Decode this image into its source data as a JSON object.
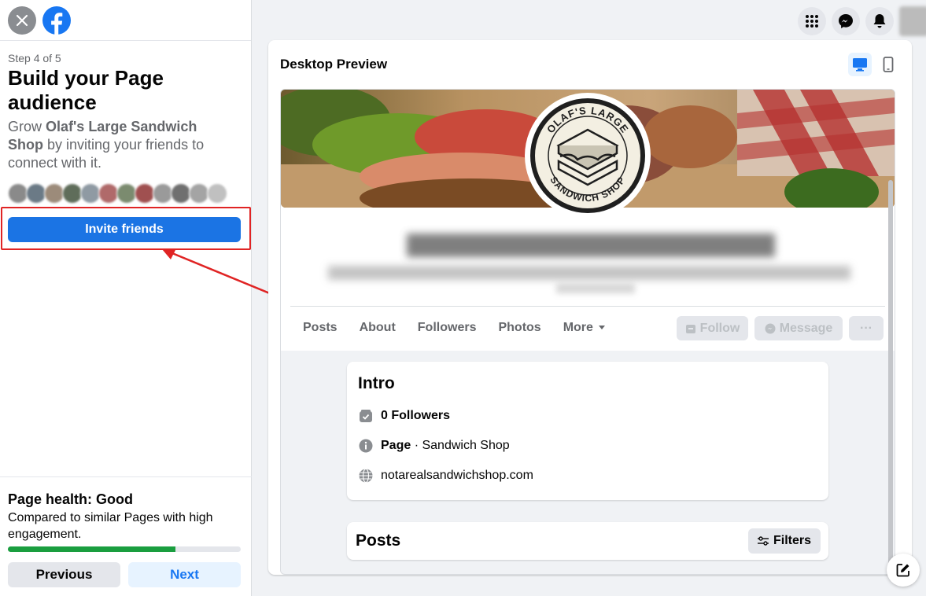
{
  "sidebar": {
    "step": "Step 4 of 5",
    "title": "Build your Page audience",
    "desc_pre": "Grow ",
    "page_name": "Olaf's Large Sandwich Shop",
    "desc_post": " by inviting your friends to connect with it.",
    "invite_label": "Invite friends",
    "health_title": "Page health: Good",
    "health_desc": "Compared to similar Pages with high engagement.",
    "health_progress": 0.72,
    "previous_label": "Previous",
    "next_label": "Next"
  },
  "preview": {
    "title": "Desktop Preview",
    "logo_top": "OLAF'S LARGE",
    "logo_bottom": "SANDWICH SHOP",
    "tabs": [
      "Posts",
      "About",
      "Followers",
      "Photos",
      "More"
    ],
    "follow_label": "Follow",
    "message_label": "Message",
    "more_actions": "···",
    "intro_title": "Intro",
    "followers": "0 Followers",
    "page_label": "Page",
    "page_category": " · Sandwich Shop",
    "website": "notarealsandwichshop.com",
    "posts_title": "Posts",
    "filters_label": "Filters"
  },
  "colors": {
    "primary": "#1b74e4",
    "highlight": "#e02424",
    "health_green": "#1a9e3f"
  }
}
